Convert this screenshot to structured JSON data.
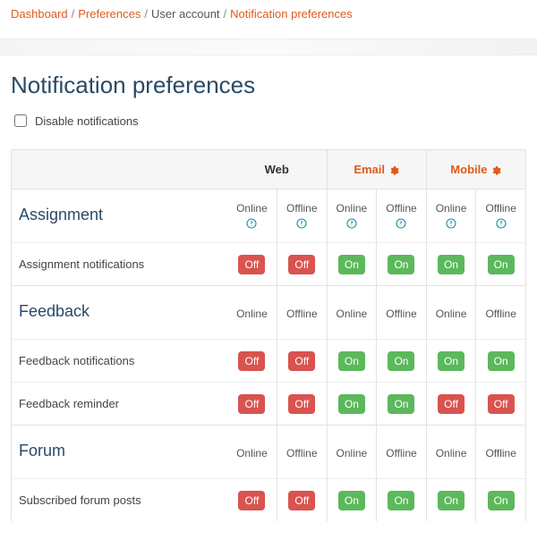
{
  "breadcrumb": {
    "items": [
      "Dashboard",
      "Preferences",
      "User account",
      "Notification preferences"
    ],
    "linked": [
      true,
      true,
      false,
      true
    ]
  },
  "page_title": "Notification preferences",
  "disable_label": "Disable notifications",
  "disable_checked": false,
  "labels": {
    "online": "Online",
    "offline": "Offline",
    "on": "On",
    "off": "Off"
  },
  "channels": [
    {
      "key": "web",
      "label": "Web",
      "has_gear": false
    },
    {
      "key": "email",
      "label": "Email",
      "has_gear": true
    },
    {
      "key": "mobile",
      "label": "Mobile",
      "has_gear": true
    }
  ],
  "sections": [
    {
      "name": "Assignment",
      "show_help": true,
      "items": [
        {
          "name": "Assignment notifications",
          "states": {
            "web": {
              "online": "Off",
              "offline": "Off"
            },
            "email": {
              "online": "On",
              "offline": "On"
            },
            "mobile": {
              "online": "On",
              "offline": "On"
            }
          }
        }
      ]
    },
    {
      "name": "Feedback",
      "show_help": false,
      "items": [
        {
          "name": "Feedback notifications",
          "states": {
            "web": {
              "online": "Off",
              "offline": "Off"
            },
            "email": {
              "online": "On",
              "offline": "On"
            },
            "mobile": {
              "online": "On",
              "offline": "On"
            }
          }
        },
        {
          "name": "Feedback reminder",
          "states": {
            "web": {
              "online": "Off",
              "offline": "Off"
            },
            "email": {
              "online": "On",
              "offline": "On"
            },
            "mobile": {
              "online": "Off",
              "offline": "Off"
            }
          }
        }
      ]
    },
    {
      "name": "Forum",
      "show_help": false,
      "items": [
        {
          "name": "Subscribed forum posts",
          "states": {
            "web": {
              "online": "Off",
              "offline": "Off"
            },
            "email": {
              "online": "On",
              "offline": "On"
            },
            "mobile": {
              "online": "On",
              "offline": "On"
            }
          }
        }
      ]
    }
  ]
}
